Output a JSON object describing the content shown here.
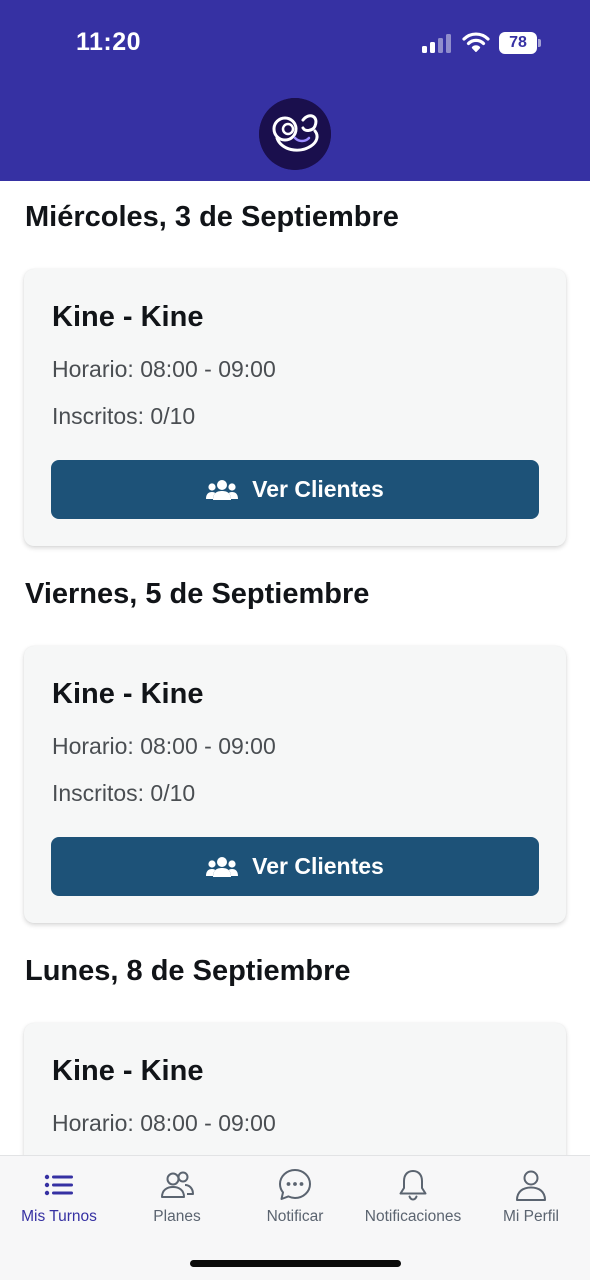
{
  "status_bar": {
    "time": "11:20",
    "battery": "78"
  },
  "days": [
    {
      "title": "Miércoles, 3 de Septiembre",
      "card": {
        "title": "Kine - Kine",
        "horario": "Horario: 08:00 - 09:00",
        "inscritos": "Inscritos: 0/10",
        "button_label": "Ver Clientes"
      }
    },
    {
      "title": "Viernes, 5 de Septiembre",
      "card": {
        "title": "Kine - Kine",
        "horario": "Horario: 08:00 - 09:00",
        "inscritos": "Inscritos: 0/10",
        "button_label": "Ver Clientes"
      }
    },
    {
      "title": "Lunes, 8 de Septiembre",
      "card": {
        "title": "Kine - Kine",
        "horario": "Horario: 08:00 - 09:00"
      }
    }
  ],
  "bottom_nav": {
    "items": [
      {
        "label": "Mis Turnos",
        "icon": "list-icon",
        "active": true
      },
      {
        "label": "Planes",
        "icon": "users-icon",
        "active": false
      },
      {
        "label": "Notificar",
        "icon": "chat-icon",
        "active": false
      },
      {
        "label": "Notificaciones",
        "icon": "bell-icon",
        "active": false
      },
      {
        "label": "Mi Perfil",
        "icon": "person-icon",
        "active": false
      }
    ]
  },
  "colors": {
    "header": "#3631a3",
    "button": "#1d5278",
    "active_nav": "#3631a3",
    "inactive_nav": "#5b6470",
    "card_bg": "#f6f7f7"
  }
}
